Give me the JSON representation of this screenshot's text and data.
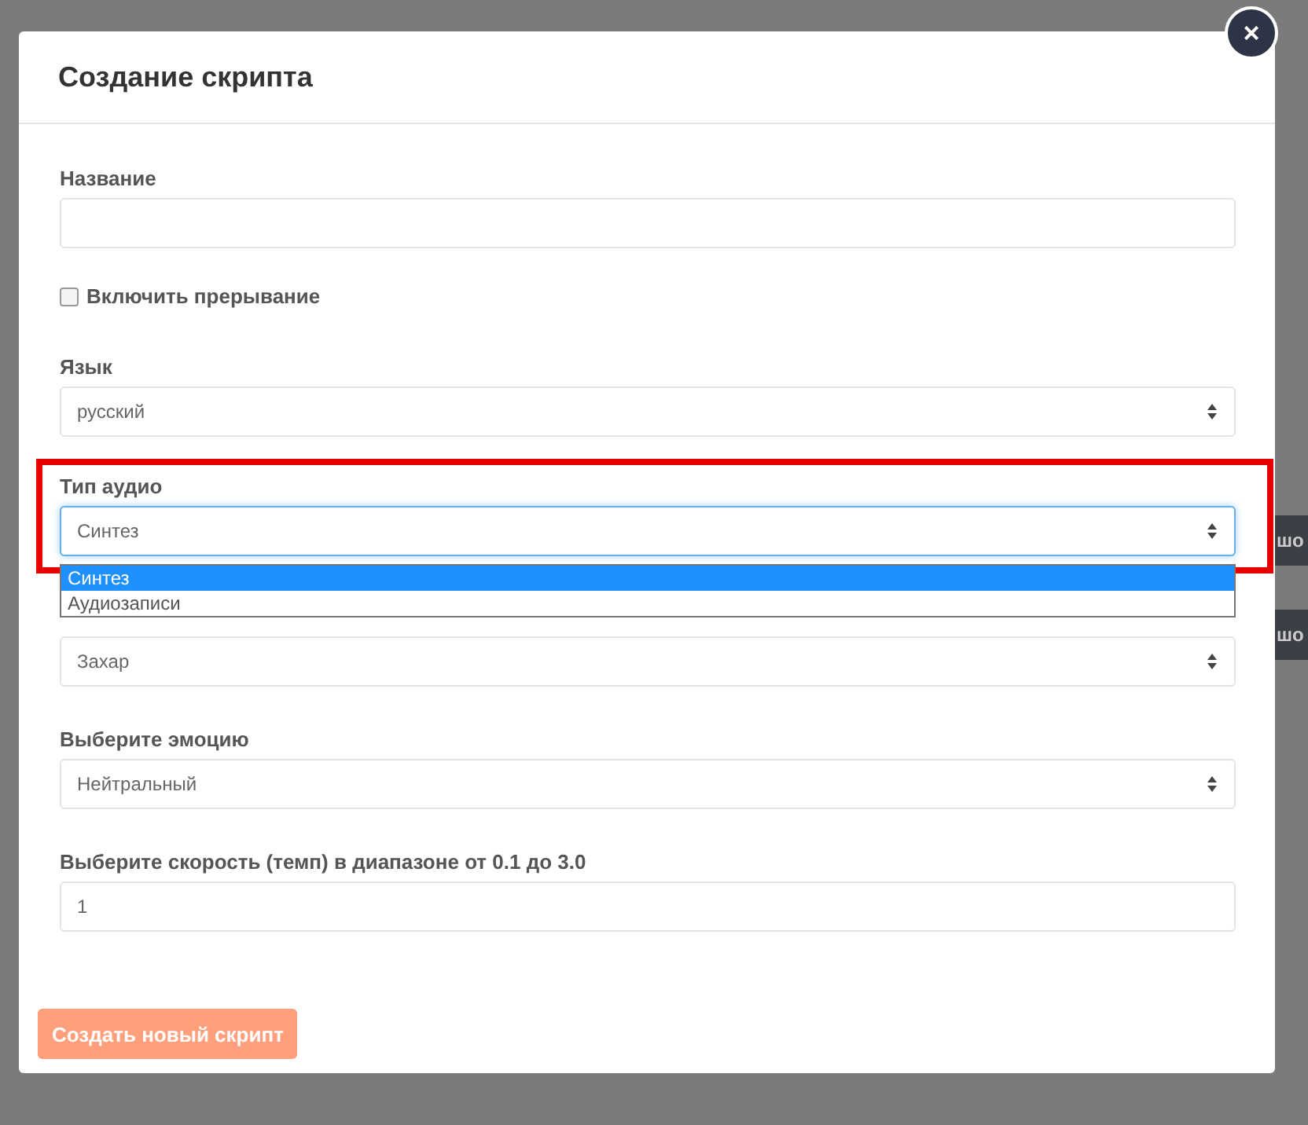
{
  "background_buttons": [
    {
      "label": "шо"
    },
    {
      "label": "шо"
    }
  ],
  "dialog": {
    "title": "Создание скрипта",
    "close": "×"
  },
  "fields": [
    {
      "kind": "text",
      "label": "Название"
    },
    {
      "kind": "checkbox",
      "label": "Включить прерывание",
      "checked": false
    },
    {
      "kind": "select",
      "label": "Язык",
      "value": "русский"
    },
    {
      "kind": "select",
      "label": "Тип аудио",
      "value": "Синтез",
      "highlighted": true,
      "expanded": true,
      "options": [
        {
          "label": "Синтез",
          "selected": true
        },
        {
          "label": "Аудиозаписи",
          "selected": false
        }
      ]
    },
    {
      "kind": "select",
      "value": "Захар"
    },
    {
      "kind": "select",
      "label": "Выберите эмоцию",
      "value": "Нейтральный"
    },
    {
      "kind": "text",
      "label": "Выберите скорость (темп) в диапазоне от 0.1 до 3.0",
      "value": "1"
    }
  ],
  "submit": {
    "label": "Создать новый скрипт",
    "disabled": true
  }
}
